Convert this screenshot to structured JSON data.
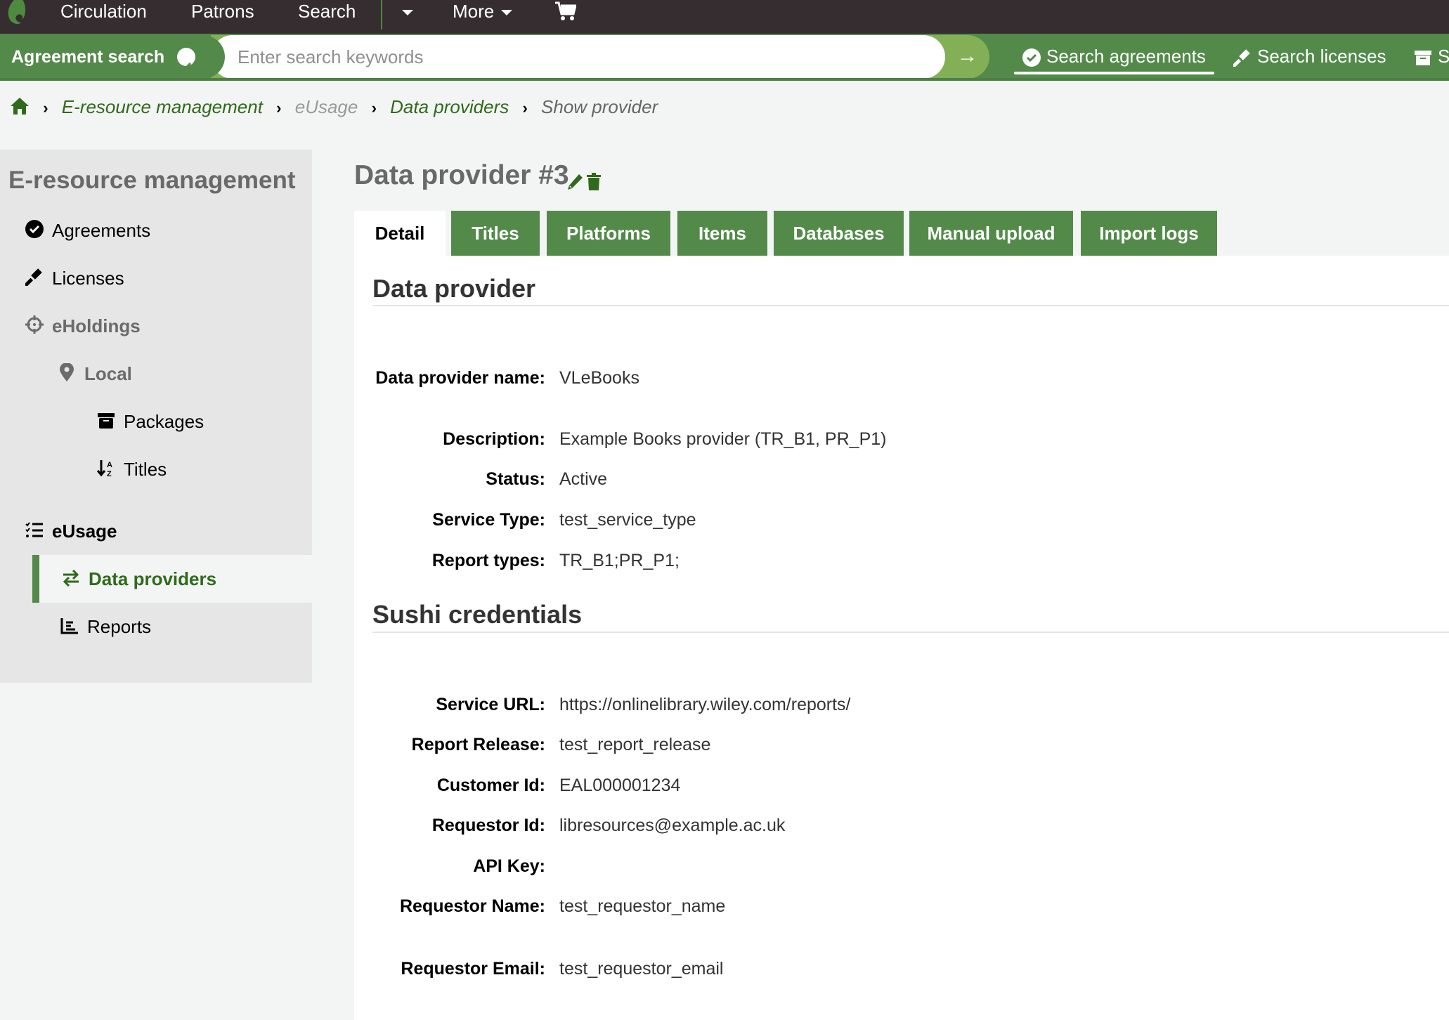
{
  "topnav": {
    "items": [
      {
        "label": "Circulation"
      },
      {
        "label": "Patrons"
      },
      {
        "label": "Search"
      },
      {
        "label": "More"
      }
    ],
    "icons": [
      "koha-logo-icon",
      "dropdown-caret-icon",
      "cart-icon"
    ]
  },
  "searchbar": {
    "label": "Agreement search",
    "placeholder": "Enter search keywords",
    "value": "",
    "submit_icon": "arrow-right-icon",
    "links": [
      {
        "label": "Search agreements",
        "icon": "check-circle-icon",
        "active": true
      },
      {
        "label": "Search licenses",
        "icon": "gavel-icon",
        "active": false
      },
      {
        "label": "S",
        "icon": "archive-box-icon",
        "active": false
      }
    ]
  },
  "breadcrumb": [
    {
      "label": "E-resource management",
      "type": "link"
    },
    {
      "label": "eUsage",
      "type": "disabled"
    },
    {
      "label": "Data providers",
      "type": "link"
    },
    {
      "label": "Show provider",
      "type": "current"
    }
  ],
  "sidebar": {
    "title": "E-resource management",
    "items": [
      {
        "label": "Agreements",
        "icon": "check-circle-icon"
      },
      {
        "label": "Licenses",
        "icon": "gavel-icon"
      },
      {
        "label": "eHoldings",
        "icon": "crosshairs-icon"
      },
      {
        "label": "Local",
        "icon": "map-marker-icon"
      },
      {
        "label": "Packages",
        "icon": "archive-box-icon"
      },
      {
        "label": "Titles",
        "icon": "sort-alpha-icon"
      },
      {
        "label": "eUsage",
        "icon": "list-check-icon"
      },
      {
        "label": "Data providers",
        "icon": "exchange-arrows-icon",
        "active": true
      },
      {
        "label": "Reports",
        "icon": "bar-chart-icon"
      }
    ]
  },
  "main": {
    "title": "Data provider #3",
    "actions": [
      "edit-pencil-icon",
      "delete-trash-icon"
    ],
    "tabs": [
      {
        "label": "Detail",
        "active": true
      },
      {
        "label": "Titles"
      },
      {
        "label": "Platforms"
      },
      {
        "label": "Items"
      },
      {
        "label": "Databases"
      },
      {
        "label": "Manual upload"
      },
      {
        "label": "Import logs"
      }
    ],
    "sections": [
      {
        "title": "Data provider",
        "fields": [
          {
            "label": "Data provider name:",
            "value": "VLeBooks"
          },
          {
            "label": "Description:",
            "value": "Example Books provider (TR_B1, PR_P1)"
          },
          {
            "label": "Status:",
            "value": "Active"
          },
          {
            "label": "Service Type:",
            "value": "test_service_type"
          },
          {
            "label": "Report types:",
            "value": "TR_B1;PR_P1;"
          }
        ]
      },
      {
        "title": "Sushi credentials",
        "fields": [
          {
            "label": "Service URL:",
            "value": "https://onlinelibrary.wiley.com/reports/"
          },
          {
            "label": "Report Release:",
            "value": "test_report_release"
          },
          {
            "label": "Customer Id:",
            "value": "EAL000001234"
          },
          {
            "label": "Requestor Id:",
            "value": "libresources@example.ac.uk"
          },
          {
            "label": "API Key:",
            "value": ""
          },
          {
            "label": "Requestor Name:",
            "value": "test_requestor_name"
          },
          {
            "label": "Requestor Email:",
            "value": "test_requestor_email"
          }
        ]
      }
    ]
  },
  "colors": {
    "topnav_bg": "#352d30",
    "brand_green": "#538a4a",
    "light_green": "#83b056",
    "link_green": "#306a1b",
    "sidebar_bg": "#e6e6e6",
    "page_bg": "#f3f4f4"
  }
}
